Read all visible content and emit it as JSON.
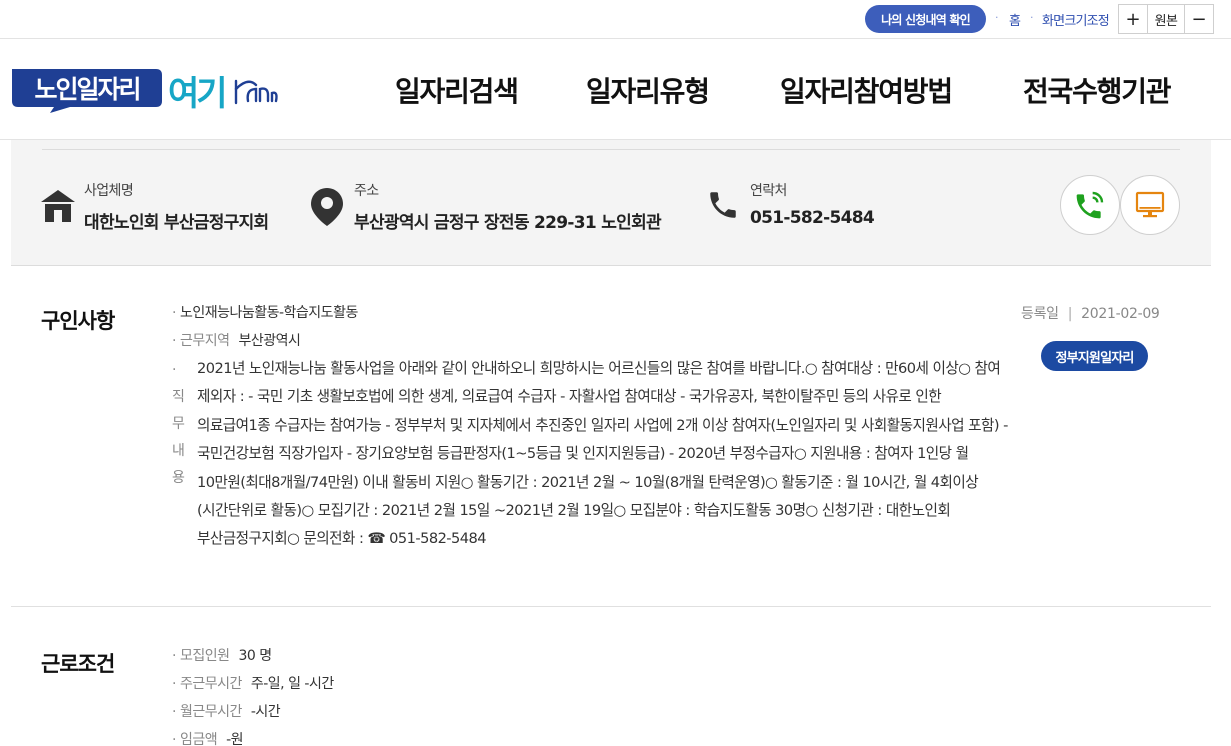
{
  "topbar": {
    "apply_check": "나의 신청내역 확인",
    "home": "홈",
    "zoom_control": "화면크기조정",
    "zoom_in": "+",
    "zoom_reset": "원본",
    "zoom_out": "−"
  },
  "header": {
    "logo_main": "노인일자리",
    "logo_accent": "여기",
    "nav": [
      "일자리검색",
      "일자리유형",
      "일자리참여방법",
      "전국수행기관"
    ]
  },
  "organization": {
    "name_label": "사업체명",
    "name_value": "대한노인회 부산금정구지회",
    "address_label": "주소",
    "address_value": "부산광역시 금정구 장전동 229-31 노인회관",
    "contact_label": "연락처",
    "contact_value": "051-582-5484",
    "call_icon": "phone-call-icon",
    "monitor_icon": "monitor-icon"
  },
  "job_posting": {
    "section_title": "구인사항",
    "job_title": "노인재능나눔활동-학습지도활동",
    "work_area_label": "근무지역",
    "work_area_value": "부산광역시",
    "duty_label": "직무내용",
    "duty_chars": [
      "직",
      "무",
      "내",
      "용"
    ],
    "duty_content": "2021년 노인재능나눔 활동사업을 아래와 같이 안내하오니 희망하시는 어르신들의 많은 참여를 바랍니다.○ 참여대상 : 만60세 이상○ 참여 제외자 :    - 국민 기초 생활보호법에 의한 생계, 의료급여 수급자    - 자활사업 참여대상    - 국가유공자, 북한이탈주민 등의 사유로 인한 의료급여1종 수급자는 참여가능    - 정부부처 및 지자체에서 추진중인 일자리 사업에 2개 이상 참여자(노인일자리 및 사회활동지원사업 포함)    - 국민건강보험 직장가입자    - 장기요양보험 등급판정자(1~5등급 및 인지지원등급)    - 2020년 부정수급자○ 지원내용 : 참여자 1인당 월 10만원(최대8개월/74만원) 이내 활동비 지원○ 활동기간 : 2021년 2월 ~ 10월(8개월 탄력운영)○ 활동기준 : 월 10시간, 월 4회이상(시간단위로 활동)○ 모집기간 : 2021년 2월 15일 ~2021년 2월 19일○ 모집분야 : 학습지도활동 30명○ 신청기관 : 대한노인회 부산금정구지회○ 문의전화 : ☎ 051-582-5484",
    "reg_label": "등록일",
    "reg_date": "2021-02-09",
    "badge": "정부지원일자리"
  },
  "work_conditions": {
    "section_title": "근로조건",
    "rows": [
      {
        "label": "모집인원",
        "value": "30 명"
      },
      {
        "label": "주근무시간",
        "value": "주-일, 일 -시간"
      },
      {
        "label": "월근무시간",
        "value": "-시간"
      },
      {
        "label": "임금액",
        "value": "-원"
      }
    ]
  },
  "colors": {
    "accent_blue": "#3d5ebb",
    "badge_blue": "#1c4aa2",
    "logo_teal": "#17a6c6",
    "call_green": "#1ea11e",
    "monitor_orange": "#e5850f"
  }
}
